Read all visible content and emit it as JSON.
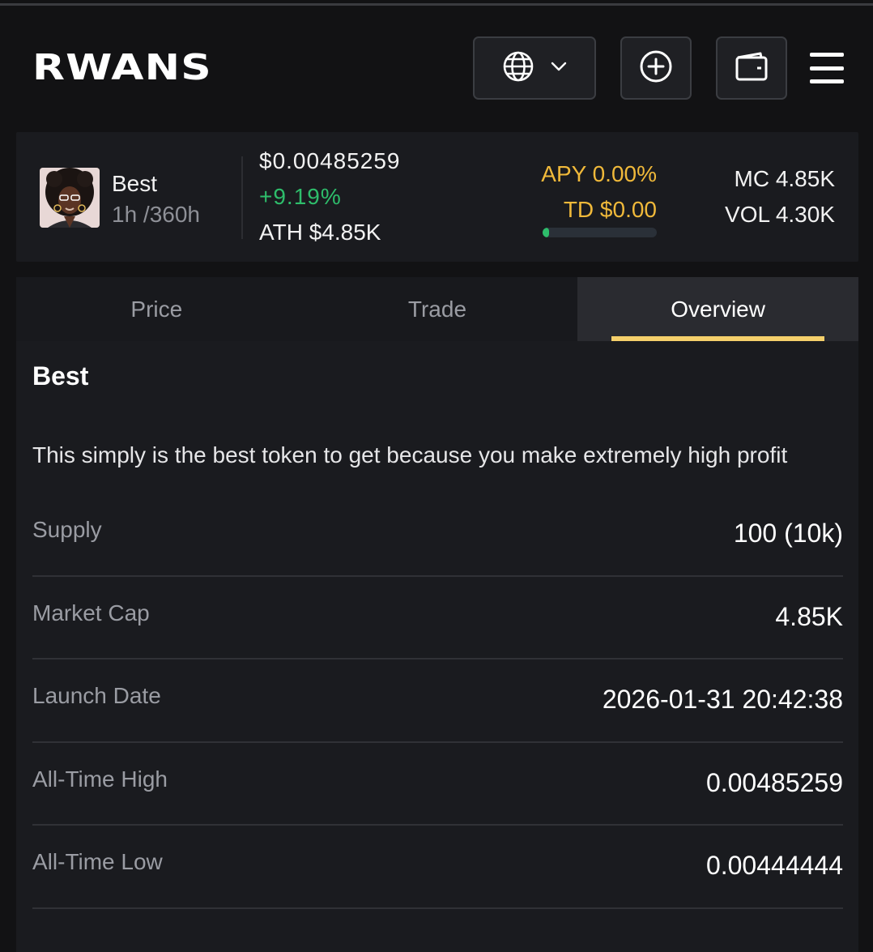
{
  "header": {
    "logo": "RWANS",
    "language_icon": "globe-icon",
    "language_chevron": "chevron-down-icon",
    "add_icon": "plus-circle-icon",
    "wallet_icon": "wallet-icon",
    "menu_icon": "hamburger-menu-icon"
  },
  "token": {
    "name": "Best",
    "duration": "1h /360h",
    "price": "$0.00485259",
    "change": "+9.19%",
    "ath": "ATH $4.85K",
    "apy": "APY 0.00%",
    "td": "TD $0.00",
    "progress_fraction": 0.06,
    "mc": "MC 4.85K",
    "vol": "VOL 4.30K"
  },
  "tabs": [
    {
      "label": "Price",
      "active": false
    },
    {
      "label": "Trade",
      "active": false
    },
    {
      "label": "Overview",
      "active": true
    }
  ],
  "overview": {
    "title": "Best",
    "description": "This simply is the best token to get because you make extremely high profit",
    "rows": [
      {
        "label": "Supply",
        "value": "100 (10k)"
      },
      {
        "label": "Market Cap",
        "value": "4.85K"
      },
      {
        "label": "Launch Date",
        "value": "2026-01-31 20:42:38"
      },
      {
        "label": "All-Time High",
        "value": "0.00485259"
      },
      {
        "label": "All-Time Low",
        "value": "0.00444444"
      }
    ]
  },
  "colors": {
    "background": "#121214",
    "card": "#1a1b1f",
    "positive": "#2ebd6b",
    "accent_yellow": "#f0b93a",
    "tab_underline": "#f5d06b"
  }
}
